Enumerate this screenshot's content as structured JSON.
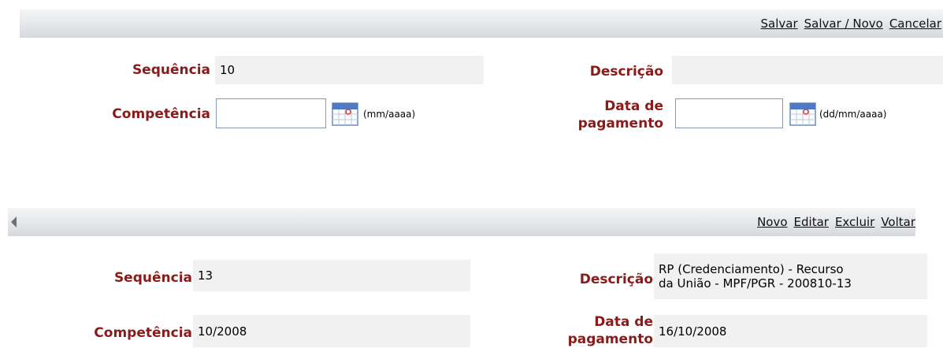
{
  "top_form": {
    "actions": [
      "Salvar",
      "Salvar / Novo",
      "Cancelar"
    ],
    "sequencia_label": "Sequência",
    "sequencia_value": "10",
    "descricao_label": "Descrição",
    "descricao_value": "",
    "competencia_label": "Competência",
    "competencia_value": "",
    "competencia_hint": "(mm/aaaa)",
    "data_pagamento_label_1": "Data de",
    "data_pagamento_label_2": "pagamento",
    "data_pagamento_value": "",
    "data_pagamento_hint": "(dd/mm/aaaa)"
  },
  "bottom_form": {
    "actions": [
      "Novo",
      "Editar",
      "Excluir",
      "Voltar"
    ],
    "sequencia_label": "Sequência",
    "sequencia_value": "13",
    "descricao_label": "Descrição",
    "descricao_value_1": "RP (Credenciamento) - Recurso",
    "descricao_value_2": "da União - MPF/PGR - 200810-13",
    "competencia_label": "Competência",
    "competencia_value": "10/2008",
    "data_pagamento_label_1": "Data de",
    "data_pagamento_label_2": "pagamento",
    "data_pagamento_value": "16/10/2008"
  },
  "icons": {
    "calendar": "calendar-icon",
    "scroll_left": "scroll-left-icon"
  }
}
